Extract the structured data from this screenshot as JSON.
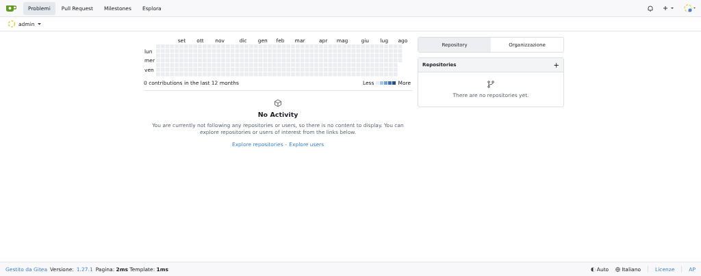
{
  "navbar": {
    "items": [
      {
        "label": "Problemi",
        "selected": true
      },
      {
        "label": "Pull Request",
        "selected": false
      },
      {
        "label": "Milestones",
        "selected": false
      },
      {
        "label": "Esplora",
        "selected": false
      }
    ]
  },
  "context": {
    "user": "admin"
  },
  "heatmap": {
    "months": [
      "set",
      "ott",
      "nov",
      "dic",
      "gen",
      "feb",
      "mar",
      "apr",
      "mag",
      "giu",
      "lug",
      "ago"
    ],
    "days": [
      "lun",
      "mer",
      "ven"
    ],
    "summary": "0 contributions in the last 12 months",
    "legend_less": "Less",
    "legend_more": "More"
  },
  "activity": {
    "title": "No Activity",
    "text": "You are currently not following any repositories or users, so there is no content to display. You can explore repositories or users of interest from the links below.",
    "link_repos": "Explore repositories",
    "separator": "-",
    "link_users": "Explore users"
  },
  "side_tabs": [
    {
      "label": "Repository",
      "selected": true
    },
    {
      "label": "Organizzazione",
      "selected": false
    }
  ],
  "repos": {
    "title": "Repositories",
    "add": "+",
    "empty": "There are no repositories yet."
  },
  "footer": {
    "powered": "Gestito da Gitea",
    "version_label": "Versione:",
    "version": "1.27.1",
    "timing": "Pagina: **2ms** Template: **1ms**",
    "theme": "Auto",
    "language": "Italiano",
    "licenses": "Licenze",
    "api": "AP"
  }
}
